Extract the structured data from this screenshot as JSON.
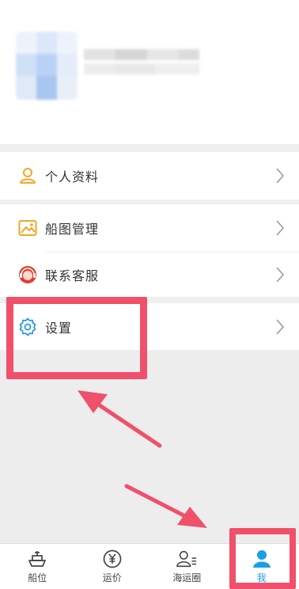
{
  "profile": {
    "avatar": "avatar (blurred)",
    "name": "username (blurred)"
  },
  "menu": {
    "profile_label": "个人资料",
    "ship_image_label": "船图管理",
    "contact_label": "联系客服",
    "settings_label": "设置"
  },
  "tabbar": {
    "tabs": [
      {
        "label": "船位",
        "icon": "ship-icon"
      },
      {
        "label": "运价",
        "icon": "yen-icon"
      },
      {
        "label": "海运圈",
        "icon": "people-icon"
      },
      {
        "label": "我",
        "icon": "user-icon"
      }
    ],
    "active_index": 3
  },
  "colors": {
    "accent_blue": "#1a9ee8",
    "annotation_red": "#f0506a",
    "icon_orange": "#f5a623",
    "icon_red": "#e53a2a",
    "gap_gray": "#efefef"
  }
}
